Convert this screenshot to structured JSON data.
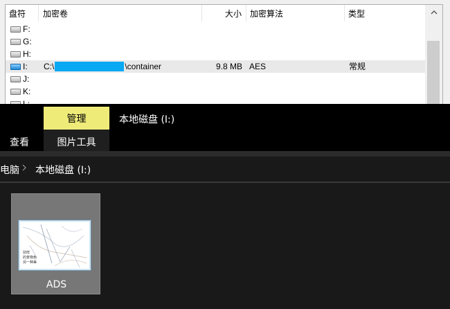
{
  "volume_list": {
    "headers": {
      "drive": "盘符",
      "volume": "加密卷",
      "size": "大小",
      "algorithm": "加密算法",
      "type": "类型"
    },
    "rows": [
      {
        "drive": "F:",
        "volume_prefix": "",
        "volume_suffix": "",
        "size": "",
        "algorithm": "",
        "type": "",
        "mounted": false
      },
      {
        "drive": "G:",
        "volume_prefix": "",
        "volume_suffix": "",
        "size": "",
        "algorithm": "",
        "type": "",
        "mounted": false
      },
      {
        "drive": "H:",
        "volume_prefix": "",
        "volume_suffix": "",
        "size": "",
        "algorithm": "",
        "type": "",
        "mounted": false
      },
      {
        "drive": "I:",
        "volume_prefix": "C:\\",
        "volume_suffix": "\\container",
        "size": "9.8 MB",
        "algorithm": "AES",
        "type": "常规",
        "mounted": true
      },
      {
        "drive": "J:",
        "volume_prefix": "",
        "volume_suffix": "",
        "size": "",
        "algorithm": "",
        "type": "",
        "mounted": false
      },
      {
        "drive": "K:",
        "volume_prefix": "",
        "volume_suffix": "",
        "size": "",
        "algorithm": "",
        "type": "",
        "mounted": false
      },
      {
        "drive": "L:",
        "volume_prefix": "",
        "volume_suffix": "",
        "size": "",
        "algorithm": "",
        "type": "",
        "mounted": false
      }
    ],
    "redaction_color": "#09a9f4",
    "scroll_up_icon": "chevron-up-icon"
  },
  "ribbon": {
    "manage_tab": "管理",
    "manage_color": "#efeb79",
    "window_title": "本地磁盘 (I:)",
    "view_tab": "查看",
    "picture_tools_tab": "图片工具"
  },
  "address": {
    "pc": "电脑",
    "separator_icon": "chevron-right-icon",
    "drive": "本地磁盘 (I:)"
  },
  "files": [
    {
      "name": "ADS",
      "thumbnail_text": [
        "别样",
        "的景物色",
        "另一种美"
      ]
    }
  ]
}
